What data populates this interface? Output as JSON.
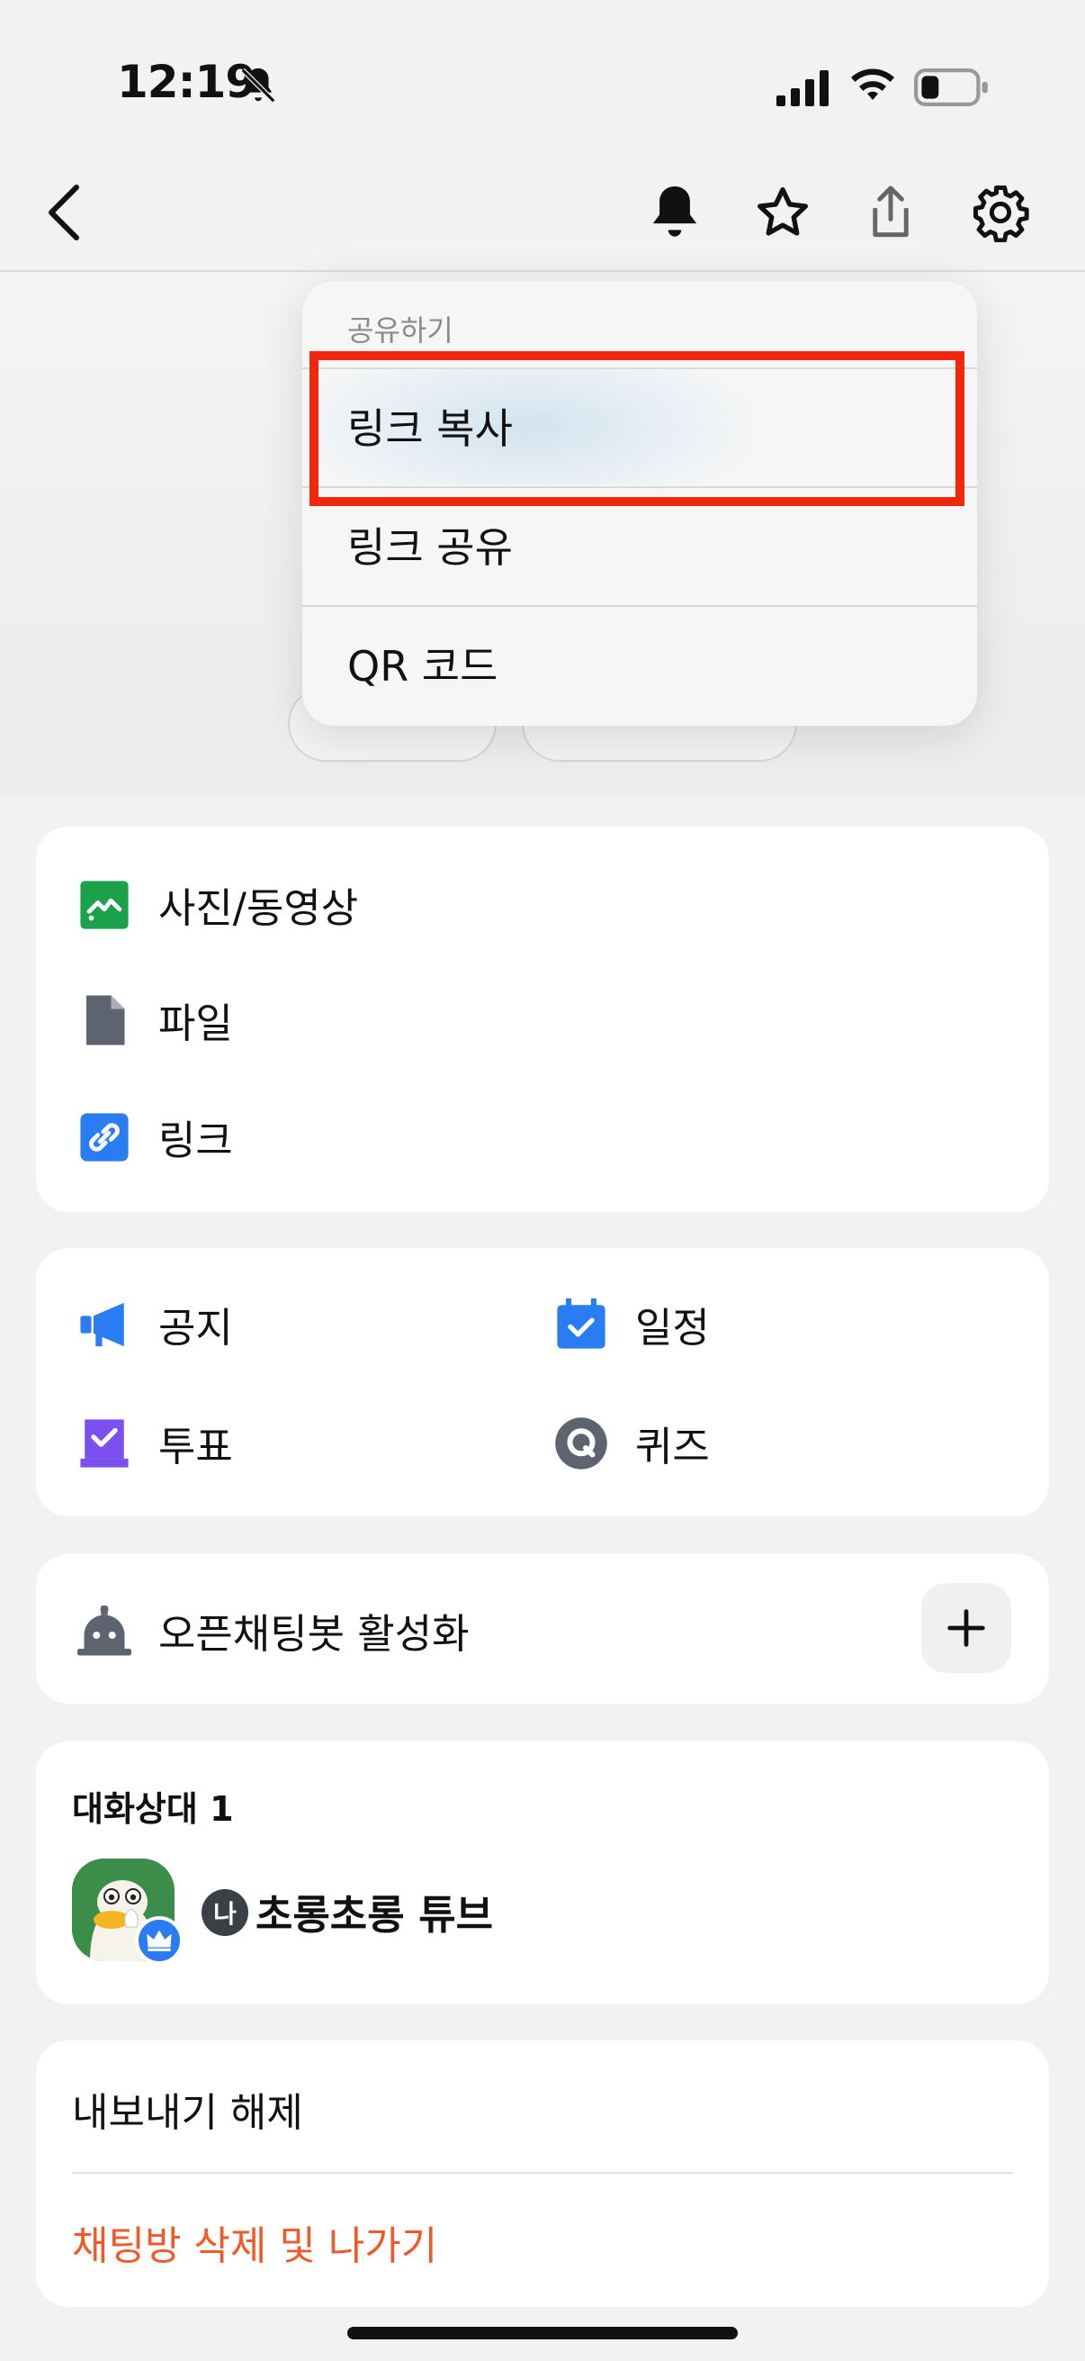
{
  "status_bar": {
    "time": "12:19"
  },
  "header": {
    "icons": [
      "back-icon",
      "bell-icon",
      "star-icon",
      "share-icon",
      "gear-icon"
    ]
  },
  "share_menu": {
    "title": "공유하기",
    "items": [
      {
        "label": "링크 복사"
      },
      {
        "label": "링크 공유"
      },
      {
        "label": "QR 코드"
      }
    ]
  },
  "media_card": {
    "items": [
      {
        "label": "사진/동영상",
        "icon": "photo-icon"
      },
      {
        "label": "파일",
        "icon": "file-icon"
      },
      {
        "label": "링크",
        "icon": "link-icon"
      }
    ]
  },
  "tools_card": {
    "items": [
      {
        "label": "공지",
        "icon": "megaphone-icon"
      },
      {
        "label": "일정",
        "icon": "calendar-icon"
      },
      {
        "label": "투표",
        "icon": "vote-icon"
      },
      {
        "label": "퀴즈",
        "icon": "quiz-icon"
      }
    ]
  },
  "bot_card": {
    "label": "오픈채팅봇 활성화",
    "icon": "bot-icon"
  },
  "members_card": {
    "title": "대화상대  1",
    "members": [
      {
        "badge": "나",
        "name": "초롱초롱 튜브"
      }
    ]
  },
  "actions_card": {
    "export": "내보내기 해제",
    "delete": "채팅방 삭제 및 나가기"
  },
  "colors": {
    "highlight": "#f2260f",
    "delete_text": "#ee5a2a",
    "accent_blue": "#2a7cf2",
    "green": "#1aa14a",
    "purple": "#7b4ff0"
  }
}
